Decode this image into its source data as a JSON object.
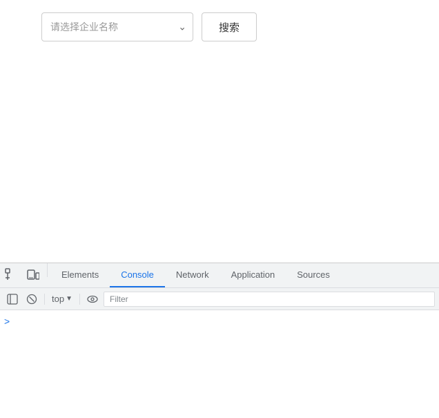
{
  "page": {
    "bg": "#ffffff"
  },
  "search": {
    "select_placeholder": "请选择企业名称",
    "button_label": "搜索"
  },
  "devtools": {
    "tabs": [
      {
        "id": "elements",
        "label": "Elements",
        "active": false
      },
      {
        "id": "console",
        "label": "Console",
        "active": true
      },
      {
        "id": "network",
        "label": "Network",
        "active": false
      },
      {
        "id": "application",
        "label": "Application",
        "active": false
      },
      {
        "id": "sources",
        "label": "Sources",
        "active": false
      }
    ],
    "console_context": "top",
    "filter_placeholder": "Filter",
    "prompt_arrow": ">"
  }
}
